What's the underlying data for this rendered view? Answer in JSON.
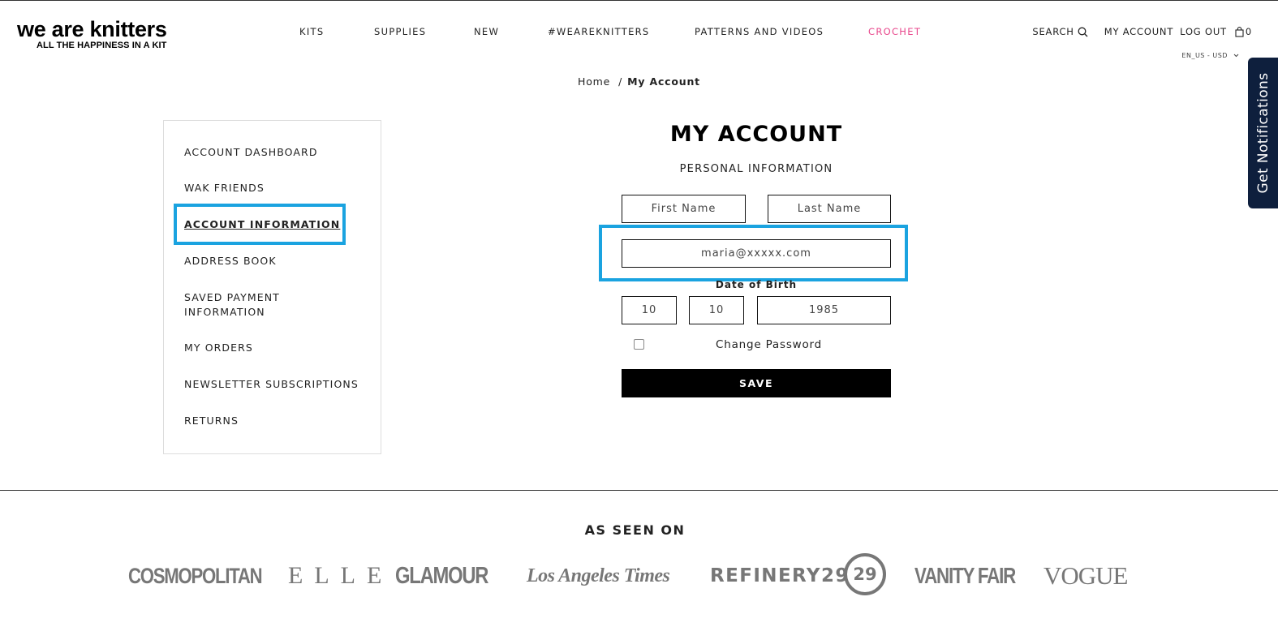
{
  "brand": {
    "name": "we are knitters",
    "tagline": "ALL THE HAPPINESS IN A KIT"
  },
  "nav": {
    "items": [
      {
        "label": "KITS"
      },
      {
        "label": "SUPPLIES"
      },
      {
        "label": "NEW"
      },
      {
        "label": "#WEAREKNITTERS"
      },
      {
        "label": "PATTERNS AND VIDEOS"
      },
      {
        "label": "CROCHET"
      }
    ],
    "accent_color": "#e8488c"
  },
  "utils": {
    "search": "SEARCH",
    "my_account": "MY ACCOUNT",
    "log_out": "LOG OUT",
    "cart_count": "0",
    "locale": "EN_US - USD"
  },
  "notifications": {
    "label": "Get Notifications",
    "color": "#0e1f3d"
  },
  "breadcrumb": {
    "home": "Home",
    "separator": "/",
    "current": "My Account"
  },
  "sidebar": {
    "items": [
      {
        "label": "ACCOUNT DASHBOARD"
      },
      {
        "label": "WAK FRIENDS"
      },
      {
        "label": "ACCOUNT INFORMATION"
      },
      {
        "label": "ADDRESS BOOK"
      },
      {
        "label": "SAVED PAYMENT INFORMATION"
      },
      {
        "label": "MY ORDERS"
      },
      {
        "label": "NEWSLETTER SUBSCRIPTIONS"
      },
      {
        "label": "RETURNS"
      }
    ],
    "active_item": "ACCOUNT INFORMATION",
    "highlight_color": "#1aa3e0"
  },
  "form": {
    "title": "MY ACCOUNT",
    "subtitle": "PERSONAL INFORMATION",
    "first_name_placeholder": "First Name",
    "last_name_placeholder": "Last Name",
    "email_value": "maria@xxxxx.com",
    "dob_label": "Date of Birth",
    "dob_month": "10",
    "dob_day": "10",
    "dob_year": "1985",
    "change_password_label": "Change Password",
    "save_label": "SAVE"
  },
  "footer": {
    "seen_title": "AS SEEN ON",
    "press": [
      "COSMOPOLITAN",
      "ELLE",
      "GLAMOUR",
      "Los Angeles Times",
      "REFINERY29",
      "29",
      "VANITY FAIR",
      "VOGUE"
    ]
  }
}
